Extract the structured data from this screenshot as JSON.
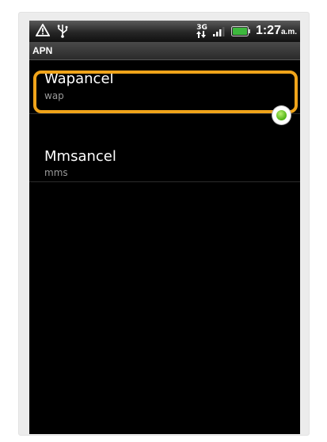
{
  "status_bar": {
    "time": "1:27",
    "ampm": "a.m.",
    "network_label": "3G",
    "icons": [
      "warning-icon",
      "usb-icon",
      "data-arrows-icon",
      "signal-icon",
      "battery-icon"
    ],
    "battery_color": "#3db83d"
  },
  "title": "APN",
  "apns": [
    {
      "name": "Wapancel",
      "type": "wap",
      "selected": true
    },
    {
      "name": "Mmsancel",
      "type": "mms",
      "selected": false
    }
  ],
  "colors": {
    "highlight": "#f0a41a",
    "radio_selected": "#4fb313"
  }
}
